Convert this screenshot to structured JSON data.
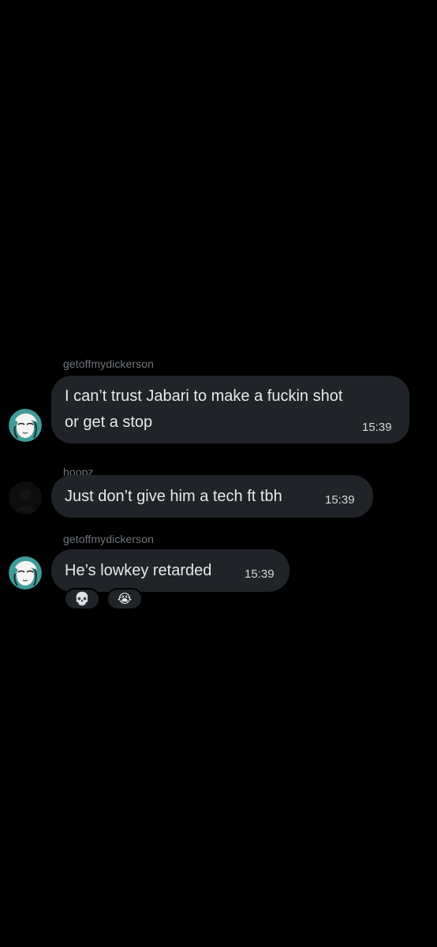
{
  "theme": {
    "background": "#000000",
    "bubble": "#202327",
    "text": "#e7e9ea",
    "muted": "#71767b",
    "avatar_accent": "#3f9c9a"
  },
  "messages": [
    {
      "sender": "getoffmydickerson",
      "line1": "I can’t trust Jabari to make a fuckin shot",
      "line2": "or get a stop",
      "time": "15:39",
      "avatar_icon": "anime-avatar-icon"
    },
    {
      "sender": "hoopz",
      "line1": "Just don’t give him a tech ft tbh",
      "time": "15:39",
      "avatar_icon": "dark-avatar-icon"
    },
    {
      "sender": "getoffmydickerson",
      "line1": "He’s lowkey retarded",
      "time": "15:39",
      "avatar_icon": "anime-avatar-icon",
      "reactions": [
        {
          "emoji": "💀",
          "icon": "skull-emoji-icon"
        },
        {
          "emoji": "😭",
          "icon": "crying-face-emoji-icon"
        }
      ]
    }
  ]
}
